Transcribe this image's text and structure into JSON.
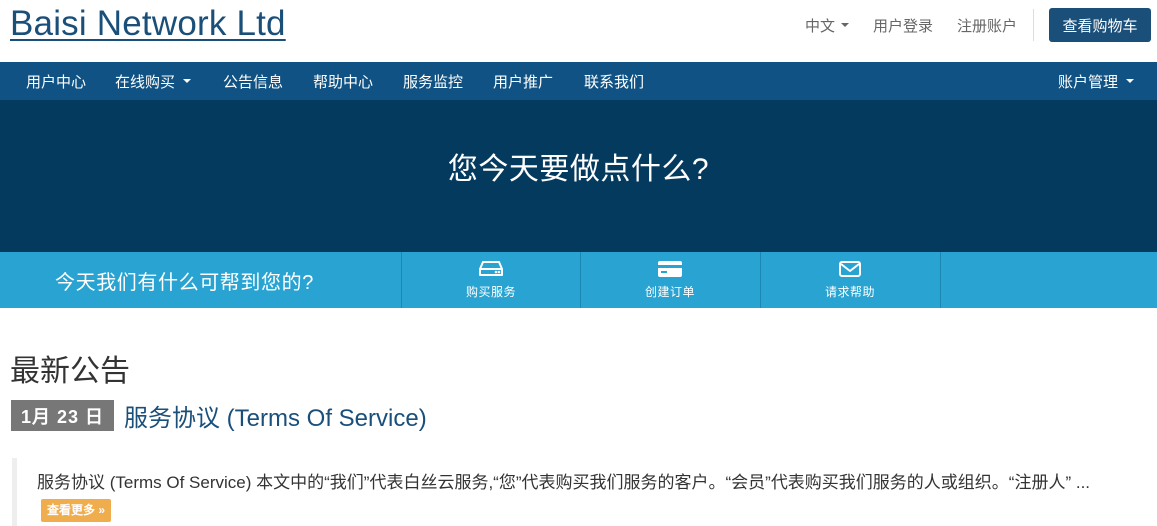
{
  "header": {
    "logo": "Baisi Network Ltd",
    "language": "中文",
    "login": "用户登录",
    "register": "注册账户",
    "cart_button": "查看购物车"
  },
  "nav": {
    "items": [
      {
        "label": "用户中心"
      },
      {
        "label": "在线购买"
      },
      {
        "label": "公告信息"
      },
      {
        "label": "帮助中心"
      },
      {
        "label": "服务监控"
      },
      {
        "label": "用户推广"
      },
      {
        "label": "联系我们"
      }
    ],
    "account": "账户管理"
  },
  "hero": {
    "title": "您今天要做点什么?"
  },
  "helpbar": {
    "question": "今天我们有什么可帮到您的?",
    "actions": [
      {
        "label": "购买服务",
        "icon": "server-icon"
      },
      {
        "label": "创建订单",
        "icon": "credit-card-icon"
      },
      {
        "label": "请求帮助",
        "icon": "envelope-icon"
      }
    ]
  },
  "announcements": {
    "section_title": "最新公告",
    "items": [
      {
        "date": "1月 23 日",
        "title": "服务协议 (Terms Of Service)",
        "excerpt": "服务协议 (Terms Of Service) 本文中的“我们”代表白丝云服务,“您”代表购买我们服务的客户。“会员”代表购买我们服务的人或组织。“注册人” ...",
        "read_more": "查看更多 »"
      }
    ]
  },
  "colors": {
    "brand": "#1a4f7a",
    "navbar": "#0f5283",
    "hero": "#053a5f",
    "helpbar": "#29a3d1",
    "read_more": "#f0ad4e",
    "date_badge": "#777777"
  }
}
